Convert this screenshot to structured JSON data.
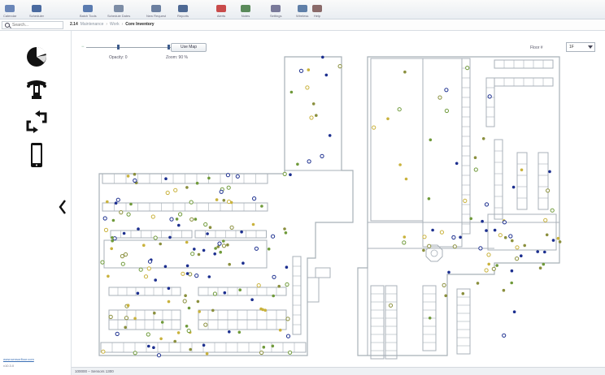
{
  "toolbar": {
    "buttons": [
      {
        "label": "Calendar",
        "color": "#6a86b8"
      },
      {
        "label": "Scheduler",
        "color": "#4a6aa0"
      },
      {
        "label": "Batch Tools",
        "color": "#5a7bb0"
      },
      {
        "label": "Schedule Dates",
        "color": "#7d8da6"
      },
      {
        "label": "New Request",
        "color": "#6b7fa0"
      },
      {
        "label": "Reports",
        "color": "#4e6994"
      },
      {
        "label": "Alerts",
        "color": "#c94b4b"
      },
      {
        "label": "Notes",
        "color": "#5a8a5a"
      },
      {
        "label": "Settings",
        "color": "#7a7a9a"
      },
      {
        "label": "Wireless",
        "color": "#5f7fa8"
      },
      {
        "label": "Help",
        "color": "#8a6a6a"
      }
    ]
  },
  "search": {
    "placeholder": "Search..."
  },
  "breadcrumb": {
    "root": "2.14",
    "level1": "Maintenance",
    "level2": "Work",
    "current": "Core Inventory"
  },
  "rail": {
    "items": [
      {
        "name": "dashboard-icon"
      },
      {
        "name": "building-plan-icon"
      },
      {
        "name": "transfer-icon"
      },
      {
        "name": "mobile-device-icon"
      }
    ],
    "link_text": "www.sensorfloor.com",
    "version_text": "v10.3.0"
  },
  "controls": {
    "slider_min": "−",
    "slider_max": "+",
    "opacity_value": 0.35,
    "zoom_value": 0.9,
    "apply_label": "Use Map",
    "scale_label": "Opacity: 0",
    "zoom_label": "Zoom: 90 %",
    "level_label": "Floor #",
    "level_value": "1F"
  },
  "map": {
    "colors": {
      "wall": "#a8b0b8",
      "dot_blue": "#1c2f8f",
      "dot_green": "#6f9a3a",
      "dot_yellow": "#c9b23c",
      "dot_olive": "#8a8f3d"
    }
  },
  "status": {
    "text": "100000 – Sensors 1300"
  }
}
